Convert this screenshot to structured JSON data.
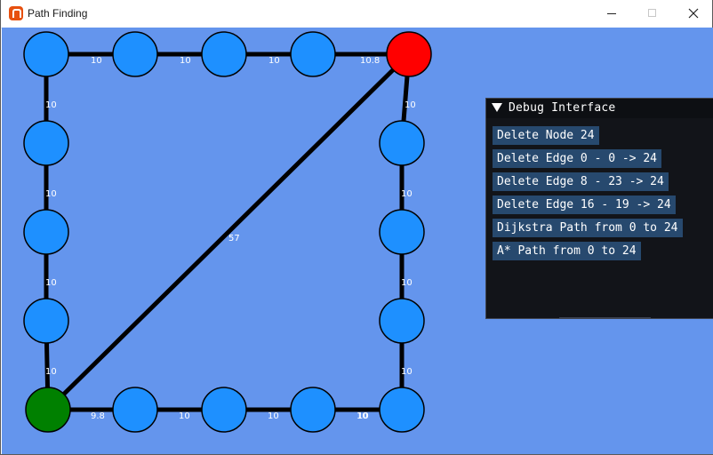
{
  "window": {
    "title": "Path Finding"
  },
  "debug": {
    "title": "Debug Interface",
    "buttons": [
      "Delete Node 24",
      "Delete Edge 0 - 0 -> 24",
      "Delete Edge 8 - 23 -> 24",
      "Delete Edge 16 - 19 -> 24",
      "Dijkstra Path from 0 to 24",
      "A* Path from 0 to 24"
    ]
  },
  "graph": {
    "colors": {
      "background": "#6495ed",
      "node": "#1e90ff",
      "start_node": "#008000",
      "goal_node": "#ff0000",
      "edge": "#000000",
      "label": "#ffffff"
    },
    "edge_labels": [
      "10",
      "10",
      "10",
      "10.8",
      "10",
      "10",
      "10",
      "10",
      "10",
      "10",
      "10",
      "10",
      "10",
      "9.8",
      "10",
      "10",
      "10",
      "57"
    ]
  }
}
